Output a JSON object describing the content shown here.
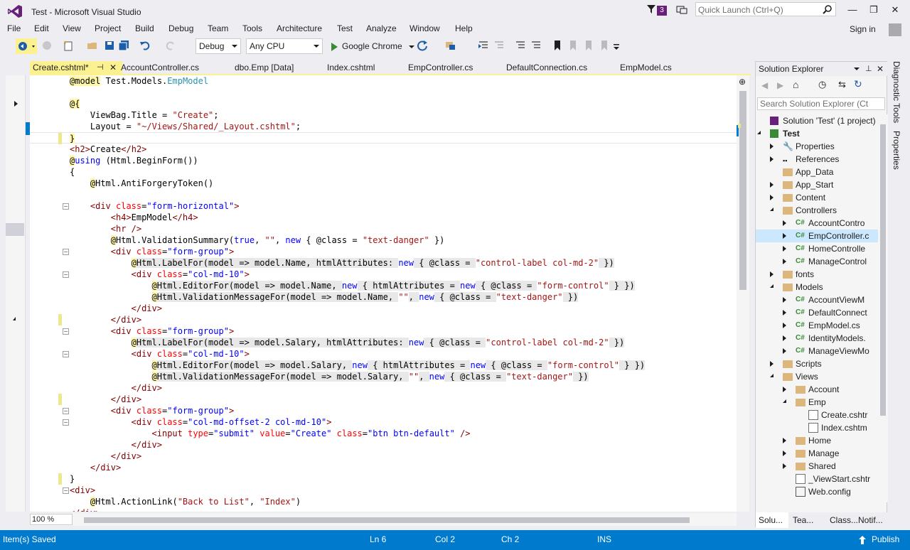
{
  "window": {
    "title": "Test - Microsoft Visual Studio",
    "notification_count": "3",
    "quick_launch_placeholder": "Quick Launch (Ctrl+Q)",
    "sign_in": "Sign in",
    "minimize": "—",
    "maximize": "❐",
    "close": "✕"
  },
  "menu": [
    "File",
    "Edit",
    "View",
    "Project",
    "Build",
    "Debug",
    "Team",
    "Tools",
    "Architecture",
    "Test",
    "Analyze",
    "Window",
    "Help"
  ],
  "toolbar": {
    "configuration": "Debug",
    "platform": "Any CPU",
    "run_target": "Google Chrome"
  },
  "tabs": [
    {
      "label": "Create.cshtml*",
      "active": true
    },
    {
      "label": "AccountController.cs",
      "active": false
    },
    {
      "label": "dbo.Emp [Data]",
      "active": false
    },
    {
      "label": "Index.cshtml",
      "active": false
    },
    {
      "label": "EmpController.cs",
      "active": false
    },
    {
      "label": "DefaultConnection.cs",
      "active": false
    },
    {
      "label": "EmpModel.cs",
      "active": false
    }
  ],
  "editor": {
    "zoom": "100 %",
    "lines": [
      {
        "indent": 0,
        "tokens": [
          [
            "razor",
            "@model"
          ],
          [
            "plain",
            " Test.Models."
          ],
          [
            "type",
            "EmpModel"
          ]
        ]
      },
      {
        "indent": 0,
        "tokens": []
      },
      {
        "indent": 0,
        "tokens": [
          [
            "razor",
            "@{"
          ]
        ]
      },
      {
        "indent": 4,
        "tokens": [
          [
            "plain",
            "ViewBag.Title = "
          ],
          [
            "str",
            "\"Create\""
          ],
          [
            "plain",
            ";"
          ]
        ]
      },
      {
        "indent": 4,
        "tokens": [
          [
            "plain",
            "Layout = "
          ],
          [
            "str",
            "\"~/Views/Shared/_Layout.cshtml\""
          ],
          [
            "plain",
            ";"
          ]
        ]
      },
      {
        "indent": 0,
        "tokens": [
          [
            "razor",
            "}"
          ]
        ],
        "mark": true
      },
      {
        "indent": 0,
        "tokens": [
          [
            "tag",
            "<h2>"
          ],
          [
            "plain",
            "Create"
          ],
          [
            "tag",
            "</h2>"
          ]
        ]
      },
      {
        "indent": 0,
        "tokens": [
          [
            "razor",
            "@"
          ],
          [
            "kw",
            "using"
          ],
          [
            "plain",
            " (Html.BeginForm())"
          ]
        ]
      },
      {
        "indent": 0,
        "tokens": [
          [
            "plain",
            "{"
          ]
        ]
      },
      {
        "indent": 4,
        "tokens": [
          [
            "razor",
            "@"
          ],
          [
            "plain",
            "Html.AntiForgeryToken()"
          ]
        ]
      },
      {
        "indent": 0,
        "tokens": []
      },
      {
        "indent": 4,
        "tokens": [
          [
            "tag",
            "<div"
          ],
          [
            "attr",
            " class"
          ],
          [
            "plain",
            "="
          ],
          [
            "atq",
            "\"form-horizontal\""
          ],
          [
            "tag",
            ">"
          ]
        ],
        "fold": true
      },
      {
        "indent": 8,
        "tokens": [
          [
            "tag",
            "<h4>"
          ],
          [
            "plain",
            "EmpModel"
          ],
          [
            "tag",
            "</h4>"
          ]
        ]
      },
      {
        "indent": 8,
        "tokens": [
          [
            "tag",
            "<hr "
          ],
          [
            "tag",
            "/>"
          ]
        ]
      },
      {
        "indent": 8,
        "tokens": [
          [
            "razor",
            "@"
          ],
          [
            "plain",
            "Html.ValidationSummary("
          ],
          [
            "kw",
            "true"
          ],
          [
            "plain",
            ", "
          ],
          [
            "str",
            "\"\""
          ],
          [
            "plain",
            ", "
          ],
          [
            "kw",
            "new"
          ],
          [
            "plain",
            " { @class = "
          ],
          [
            "str",
            "\"text-danger\""
          ],
          [
            "plain",
            " })"
          ]
        ]
      },
      {
        "indent": 8,
        "tokens": [
          [
            "tag",
            "<div"
          ],
          [
            "attr",
            " class"
          ],
          [
            "plain",
            "="
          ],
          [
            "atq",
            "\"form-group\""
          ],
          [
            "tag",
            ">"
          ]
        ],
        "fold": true
      },
      {
        "indent": 12,
        "tokens": [
          [
            "razor",
            "@"
          ],
          [
            "plain",
            "Html.LabelFor(model => model.Name, htmlAttributes: "
          ],
          [
            "kw",
            "new"
          ],
          [
            "plain",
            " { @class = "
          ],
          [
            "str",
            "\"control-label col-md-2\""
          ],
          [
            "plain",
            " })"
          ]
        ],
        "shade": true
      },
      {
        "indent": 12,
        "tokens": [
          [
            "tag",
            "<div"
          ],
          [
            "attr",
            " class"
          ],
          [
            "plain",
            "="
          ],
          [
            "atq",
            "\"col-md-10\""
          ],
          [
            "tag",
            ">"
          ]
        ],
        "fold": true
      },
      {
        "indent": 16,
        "tokens": [
          [
            "razor",
            "@"
          ],
          [
            "plain",
            "Html.EditorFor(model => model.Name, "
          ],
          [
            "kw",
            "new"
          ],
          [
            "plain",
            " { htmlAttributes = "
          ],
          [
            "kw",
            "new"
          ],
          [
            "plain",
            " { @class = "
          ],
          [
            "str",
            "\"form-control\""
          ],
          [
            "plain",
            " } })"
          ]
        ],
        "shade": true
      },
      {
        "indent": 16,
        "tokens": [
          [
            "razor",
            "@"
          ],
          [
            "plain",
            "Html.ValidationMessageFor(model => model.Name, "
          ],
          [
            "str",
            "\"\""
          ],
          [
            "plain",
            ", "
          ],
          [
            "kw",
            "new"
          ],
          [
            "plain",
            " { @class = "
          ],
          [
            "str",
            "\"text-danger\""
          ],
          [
            "plain",
            " })"
          ]
        ],
        "shade": true
      },
      {
        "indent": 12,
        "tokens": [
          [
            "tag",
            "</div>"
          ]
        ]
      },
      {
        "indent": 8,
        "tokens": [
          [
            "tag",
            "</div>"
          ]
        ],
        "mark": true
      },
      {
        "indent": 8,
        "tokens": [
          [
            "tag",
            "<div"
          ],
          [
            "attr",
            " class"
          ],
          [
            "plain",
            "="
          ],
          [
            "atq",
            "\"form-group\""
          ],
          [
            "tag",
            ">"
          ]
        ],
        "fold": true
      },
      {
        "indent": 12,
        "tokens": [
          [
            "razor",
            "@"
          ],
          [
            "plain",
            "Html.LabelFor(model => model.Salary, htmlAttributes: "
          ],
          [
            "kw",
            "new"
          ],
          [
            "plain",
            " { @class = "
          ],
          [
            "str",
            "\"control-label col-md-2\""
          ],
          [
            "plain",
            " })"
          ]
        ],
        "shade": true
      },
      {
        "indent": 12,
        "tokens": [
          [
            "tag",
            "<div"
          ],
          [
            "attr",
            " class"
          ],
          [
            "plain",
            "="
          ],
          [
            "atq",
            "\"col-md-10\""
          ],
          [
            "tag",
            ">"
          ]
        ],
        "fold": true
      },
      {
        "indent": 16,
        "tokens": [
          [
            "razor",
            "@"
          ],
          [
            "plain",
            "Html.EditorFor(model => model.Salary, "
          ],
          [
            "kw",
            "new"
          ],
          [
            "plain",
            " { htmlAttributes = "
          ],
          [
            "kw",
            "new"
          ],
          [
            "plain",
            " { @class = "
          ],
          [
            "str",
            "\"form-control\""
          ],
          [
            "plain",
            " } })"
          ]
        ],
        "shade": true
      },
      {
        "indent": 16,
        "tokens": [
          [
            "razor",
            "@"
          ],
          [
            "plain",
            "Html.ValidationMessageFor(model => model.Salary, "
          ],
          [
            "str",
            "\"\""
          ],
          [
            "plain",
            ", "
          ],
          [
            "kw",
            "new"
          ],
          [
            "plain",
            " { @class = "
          ],
          [
            "str",
            "\"text-danger\""
          ],
          [
            "plain",
            " })"
          ]
        ],
        "shade": true
      },
      {
        "indent": 12,
        "tokens": [
          [
            "tag",
            "</div>"
          ]
        ]
      },
      {
        "indent": 8,
        "tokens": [
          [
            "tag",
            "</div>"
          ]
        ],
        "mark": true
      },
      {
        "indent": 8,
        "tokens": [
          [
            "tag",
            "<div"
          ],
          [
            "attr",
            " class"
          ],
          [
            "plain",
            "="
          ],
          [
            "atq",
            "\"form-group\""
          ],
          [
            "tag",
            ">"
          ]
        ],
        "fold": true
      },
      {
        "indent": 12,
        "tokens": [
          [
            "tag",
            "<div"
          ],
          [
            "attr",
            " class"
          ],
          [
            "plain",
            "="
          ],
          [
            "atq",
            "\"col-md-offset-2 col-md-10\""
          ],
          [
            "tag",
            ">"
          ]
        ],
        "fold": true
      },
      {
        "indent": 16,
        "tokens": [
          [
            "tag",
            "<input"
          ],
          [
            "attr",
            " type"
          ],
          [
            "plain",
            "="
          ],
          [
            "atq",
            "\"submit\""
          ],
          [
            "attr",
            " value"
          ],
          [
            "plain",
            "="
          ],
          [
            "atq",
            "\"Create\""
          ],
          [
            "attr",
            " class"
          ],
          [
            "plain",
            "="
          ],
          [
            "atq",
            "\"btn btn-default\""
          ],
          [
            "tag",
            " />"
          ]
        ]
      },
      {
        "indent": 12,
        "tokens": [
          [
            "tag",
            "</div>"
          ]
        ]
      },
      {
        "indent": 8,
        "tokens": [
          [
            "tag",
            "</div>"
          ]
        ]
      },
      {
        "indent": 4,
        "tokens": [
          [
            "tag",
            "</div>"
          ]
        ]
      },
      {
        "indent": 0,
        "tokens": [
          [
            "plain",
            "}"
          ]
        ],
        "mark": true
      },
      {
        "indent": 0,
        "tokens": [
          [
            "tag",
            "<div>"
          ]
        ],
        "fold": true
      },
      {
        "indent": 4,
        "tokens": [
          [
            "razor",
            "@"
          ],
          [
            "plain",
            "Html.ActionLink("
          ],
          [
            "str",
            "\"Back to List\""
          ],
          [
            "plain",
            ", "
          ],
          [
            "str",
            "\"Index\""
          ],
          [
            "plain",
            ")"
          ]
        ]
      },
      {
        "indent": 0,
        "tokens": [
          [
            "tag",
            "</div>"
          ]
        ]
      }
    ]
  },
  "solution_explorer": {
    "title": "Solution Explorer",
    "search_placeholder": "Search Solution Explorer (Ct",
    "items": [
      {
        "label": "Solution 'Test' (1 project)",
        "level": 0,
        "icon": "solution",
        "exp": "none"
      },
      {
        "label": "Test",
        "level": 0,
        "icon": "project",
        "exp": "open",
        "bold": true
      },
      {
        "label": "Properties",
        "level": 1,
        "icon": "wrench",
        "exp": "closed"
      },
      {
        "label": "References",
        "level": 1,
        "icon": "refs",
        "exp": "closed"
      },
      {
        "label": "App_Data",
        "level": 1,
        "icon": "folder",
        "exp": "none"
      },
      {
        "label": "App_Start",
        "level": 1,
        "icon": "folder",
        "exp": "closed"
      },
      {
        "label": "Content",
        "level": 1,
        "icon": "folder",
        "exp": "closed"
      },
      {
        "label": "Controllers",
        "level": 1,
        "icon": "folder",
        "exp": "open"
      },
      {
        "label": "AccountContro",
        "level": 2,
        "icon": "cs",
        "exp": "closed"
      },
      {
        "label": "EmpController.c",
        "level": 2,
        "icon": "cs",
        "exp": "closed",
        "selected": true
      },
      {
        "label": "HomeControlle",
        "level": 2,
        "icon": "cs",
        "exp": "closed"
      },
      {
        "label": "ManageControl",
        "level": 2,
        "icon": "cs",
        "exp": "closed"
      },
      {
        "label": "fonts",
        "level": 1,
        "icon": "folder",
        "exp": "closed"
      },
      {
        "label": "Models",
        "level": 1,
        "icon": "folder",
        "exp": "open"
      },
      {
        "label": "AccountViewM",
        "level": 2,
        "icon": "cs",
        "exp": "closed"
      },
      {
        "label": "DefaultConnect",
        "level": 2,
        "icon": "cs",
        "exp": "closed"
      },
      {
        "label": "EmpModel.cs",
        "level": 2,
        "icon": "cs",
        "exp": "closed"
      },
      {
        "label": "IdentityModels.",
        "level": 2,
        "icon": "cs",
        "exp": "closed"
      },
      {
        "label": "ManageViewMo",
        "level": 2,
        "icon": "cs",
        "exp": "closed"
      },
      {
        "label": "Scripts",
        "level": 1,
        "icon": "folder",
        "exp": "closed"
      },
      {
        "label": "Views",
        "level": 1,
        "icon": "folder",
        "exp": "open"
      },
      {
        "label": "Account",
        "level": 2,
        "icon": "folder",
        "exp": "closed"
      },
      {
        "label": "Emp",
        "level": 2,
        "icon": "folder",
        "exp": "open"
      },
      {
        "label": "Create.cshtr",
        "level": 3,
        "icon": "page",
        "exp": "none"
      },
      {
        "label": "Index.cshtm",
        "level": 3,
        "icon": "page",
        "exp": "none"
      },
      {
        "label": "Home",
        "level": 2,
        "icon": "folder",
        "exp": "closed"
      },
      {
        "label": "Manage",
        "level": 2,
        "icon": "folder",
        "exp": "closed"
      },
      {
        "label": "Shared",
        "level": 2,
        "icon": "folder",
        "exp": "closed"
      },
      {
        "label": "_ViewStart.cshtr",
        "level": 2,
        "icon": "page",
        "exp": "none"
      },
      {
        "label": "Web.config",
        "level": 2,
        "icon": "config",
        "exp": "none"
      }
    ],
    "bottom_tabs": [
      "Solu...",
      "Tea...",
      "Class...",
      "Notif..."
    ]
  },
  "side_tabs": [
    "Diagnostic Tools",
    "Properties"
  ],
  "status": {
    "message": "Item(s) Saved",
    "ln": "Ln 6",
    "col": "Col 2",
    "ch": "Ch 2",
    "mode": "INS",
    "publish": "Publish"
  },
  "colors": {
    "accent": "#007acc",
    "vs_purple": "#68217a",
    "active_tab": "#fcf191",
    "selection": "#cce8ff"
  }
}
